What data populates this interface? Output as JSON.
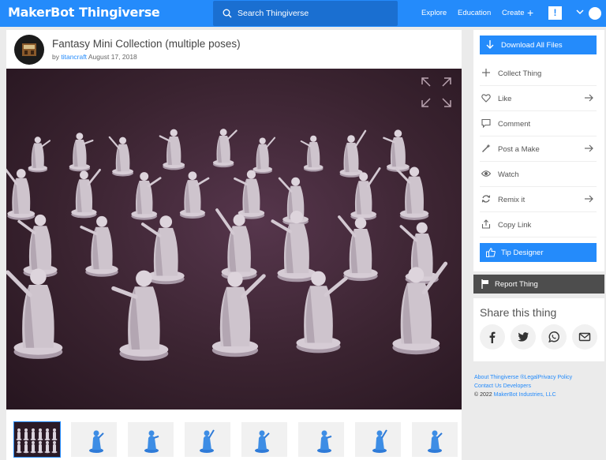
{
  "nav": {
    "brand_maker": "MakerBot",
    "brand_thing": "Thingiverse",
    "search_placeholder": "Search Thingiverse",
    "explore": "Explore",
    "education": "Education",
    "create": "Create",
    "notify": "!"
  },
  "thing": {
    "title": "Fantasy Mini Collection (multiple poses)",
    "by": "by",
    "author": "titancraft",
    "date": "August 17, 2018"
  },
  "thumbnails_count": 8,
  "sidebar": {
    "download": "Download All Files",
    "actions": [
      {
        "label": "Collect Thing",
        "icon": "plus-icon",
        "arrow": false
      },
      {
        "label": "Like",
        "icon": "heart-icon",
        "arrow": true
      },
      {
        "label": "Comment",
        "icon": "comment-icon",
        "arrow": false
      },
      {
        "label": "Post a Make",
        "icon": "wand-icon",
        "arrow": true
      },
      {
        "label": "Watch",
        "icon": "eye-icon",
        "arrow": false
      },
      {
        "label": "Remix it",
        "icon": "remix-icon",
        "arrow": true
      },
      {
        "label": "Copy Link",
        "icon": "share-icon",
        "arrow": false
      }
    ],
    "tip": "Tip Designer",
    "report": "Report Thing"
  },
  "share": {
    "title": "Share this thing",
    "buttons": [
      "facebook-icon",
      "twitter-icon",
      "whatsapp-icon",
      "email-icon"
    ]
  },
  "footer": {
    "about": "About Thingiverse",
    "reg": "®",
    "legal": "Legal",
    "privacy": "Privacy Policy",
    "contact": "Contact Us",
    "developers": "Developers",
    "copy": "© 2022",
    "company": "MakerBot Industries, LLC"
  },
  "colors": {
    "accent": "#248bfb",
    "nav_search": "#1a6fd1",
    "report": "#4d4d4d"
  }
}
